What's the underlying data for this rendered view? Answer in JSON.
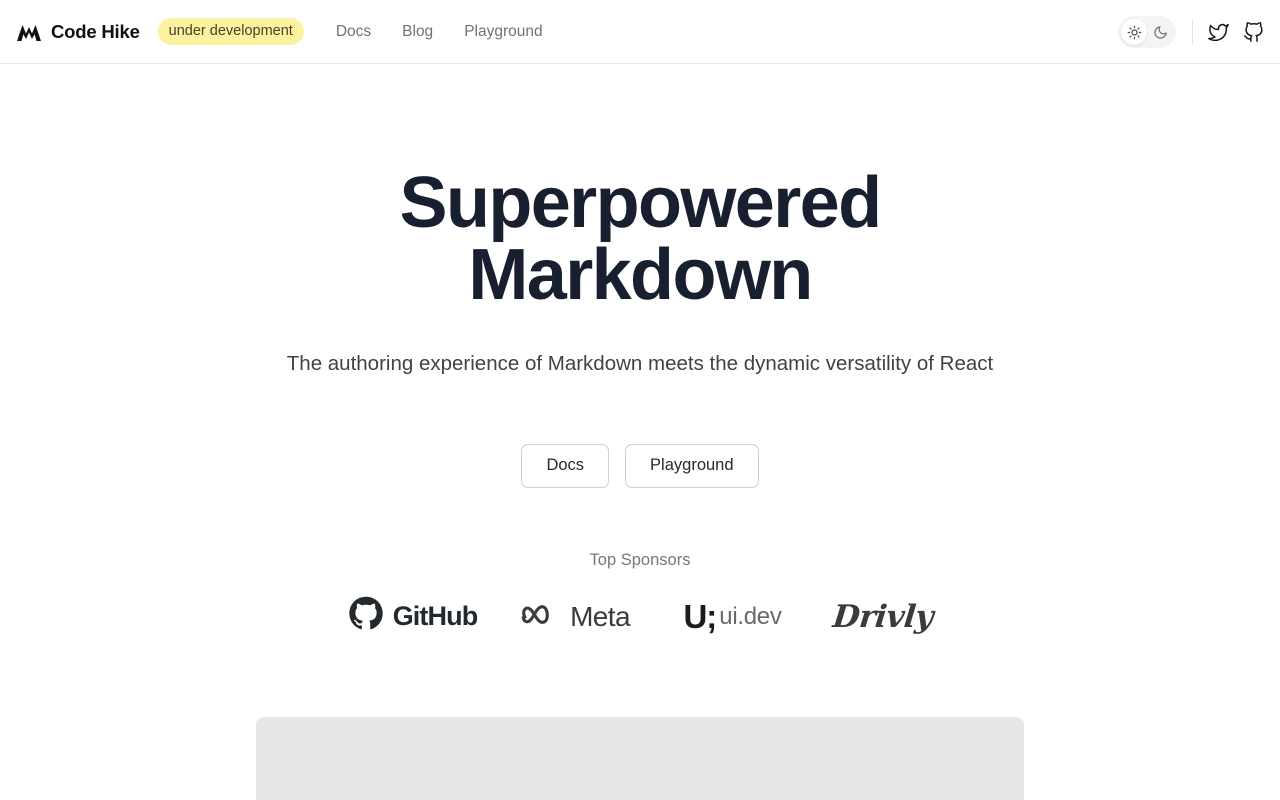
{
  "header": {
    "brand": {
      "name": "Code Hike",
      "logo_icon": "mountain-logo-icon"
    },
    "badge": "under development",
    "nav": [
      {
        "label": "Docs"
      },
      {
        "label": "Blog"
      },
      {
        "label": "Playground"
      }
    ],
    "theme_toggle": {
      "light_icon": "sun-icon",
      "dark_icon": "moon-icon",
      "active": "light"
    },
    "social": [
      {
        "name": "twitter-icon"
      },
      {
        "name": "github-icon"
      }
    ]
  },
  "hero": {
    "title_line1": "Superpowered",
    "title_line2": "Markdown",
    "subtitle": "The authoring experience of Markdown meets the dynamic versatility of React",
    "cta": [
      {
        "label": "Docs"
      },
      {
        "label": "Playground"
      }
    ]
  },
  "sponsors": {
    "title": "Top Sponsors",
    "items": [
      {
        "name": "GitHub",
        "wordmark": "GitHub"
      },
      {
        "name": "Meta",
        "wordmark": "Meta"
      },
      {
        "name": "ui.dev",
        "mark": "U;",
        "wordmark": "ui.dev"
      },
      {
        "name": "Drivly",
        "wordmark": "Drivly"
      }
    ]
  },
  "colors": {
    "badge_bg": "#fdf2a0",
    "badge_text": "#4a4023",
    "title": "#18202f",
    "panel": "#e7e7e7"
  }
}
